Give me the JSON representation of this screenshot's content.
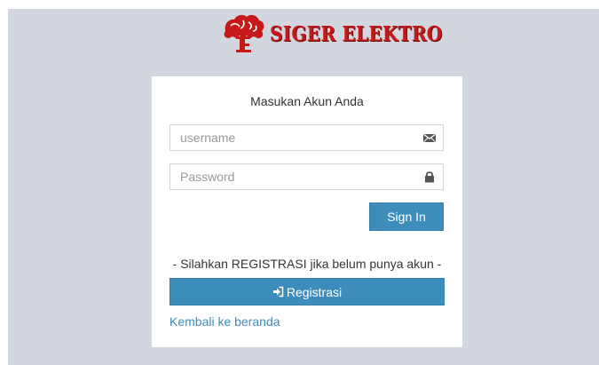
{
  "brand": {
    "name": "SIGER ELEKTRO",
    "logo_icon": "siger-crown-icon",
    "color": "#c61a1a"
  },
  "login": {
    "message": "Masukan Akun Anda",
    "username_placeholder": "username",
    "username_value": "",
    "username_icon": "envelope-icon",
    "password_placeholder": "Password",
    "password_value": "",
    "password_icon": "lock-icon",
    "signin_label": "Sign In"
  },
  "register": {
    "note": "- Silahkan REGISTRASI jika belum punya akun -",
    "button_label": "Registrasi",
    "button_icon": "sign-in-icon"
  },
  "back_link": "Kembali ke beranda",
  "colors": {
    "background": "#d2d6de",
    "primary": "#3c8dbc",
    "link": "#3c8dbc"
  }
}
